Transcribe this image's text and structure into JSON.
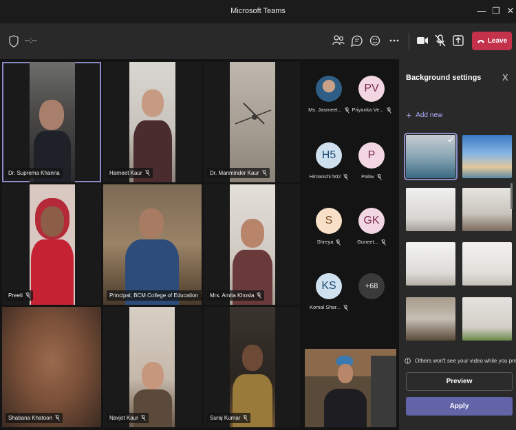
{
  "window": {
    "title": "Microsoft Teams",
    "min": "—",
    "max": "❐",
    "close": "✕"
  },
  "toolbar": {
    "timer": "--:--",
    "leave_label": "Leave"
  },
  "tiles": [
    {
      "name": "Dr. Suprema Khanna"
    },
    {
      "name": "Harneet Kaur"
    },
    {
      "name": "Dr. Manminder Kaur"
    },
    {
      "name": "Preeti"
    },
    {
      "name": "Principal, BCM College of Education"
    },
    {
      "name": "Mrs. Amita Khosla"
    },
    {
      "name": "Shabana Khatoon"
    },
    {
      "name": "Navjot Kaur"
    },
    {
      "name": "Suraj Kumar"
    }
  ],
  "roster": [
    {
      "initials": "",
      "name": "Ms. Jasmeet...",
      "color": "#6a8fb0"
    },
    {
      "initials": "PV",
      "name": "Priyanka Ve...",
      "color": "#f2d6e2"
    },
    {
      "initials": "H5",
      "name": "Himanshi 502",
      "color": "#cfe0ef"
    },
    {
      "initials": "P",
      "name": "Palav",
      "color": "#f2d6e2"
    },
    {
      "initials": "S",
      "name": "Shreya",
      "color": "#f7e0c7"
    },
    {
      "initials": "GK",
      "name": "Guneet...",
      "color": "#f2d6e2"
    },
    {
      "initials": "KS",
      "name": "Komal Shar...",
      "color": "#cfe0ef"
    },
    {
      "initials": "+68",
      "name": "",
      "color": "#3a3a3a"
    }
  ],
  "panel": {
    "title": "Background settings",
    "close": "X",
    "add_new": "Add new",
    "note": "Others won't see your video while you preview.",
    "preview_label": "Preview",
    "apply_label": "Apply"
  },
  "colors": {
    "accent": "#6264a7",
    "leave": "#c4314b",
    "link": "#aeb0ff"
  }
}
